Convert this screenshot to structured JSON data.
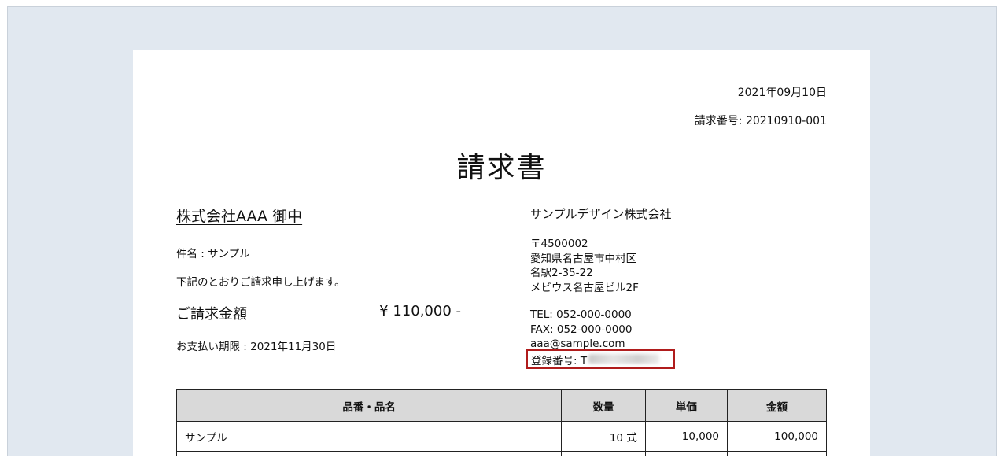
{
  "invoice": {
    "date": "2021年09月10日",
    "number_line": "請求番号: 20210910-001",
    "title": "請求書",
    "client": "株式会社AAA 御中",
    "subject": "件名 : サンプル",
    "intro": "下記のとおりご請求申し上げます。",
    "amount_label": "ご請求金額",
    "amount_value": "¥ 110,000 -",
    "due": "お支払い期限 : 2021年11月30日"
  },
  "issuer": {
    "name": "サンプルデザイン株式会社",
    "postal": "〒4500002",
    "address1": "愛知県名古屋市中村区",
    "address2": "名駅2-35-22",
    "address3": "メビウス名古屋ビル2F",
    "tel": "TEL: 052-000-0000",
    "fax": "FAX: 052-000-0000",
    "email": "aaa@sample.com",
    "registration": "登録番号: T"
  },
  "table": {
    "headers": [
      "品番・品名",
      "数量",
      "単価",
      "金額"
    ],
    "rows": [
      [
        "サンプル",
        "10 式",
        "10,000",
        "100,000"
      ]
    ]
  },
  "colors": {
    "frame_bg": "#e1e8f0",
    "highlight": "#b01c1c",
    "header_bg": "#d9d9d9"
  }
}
